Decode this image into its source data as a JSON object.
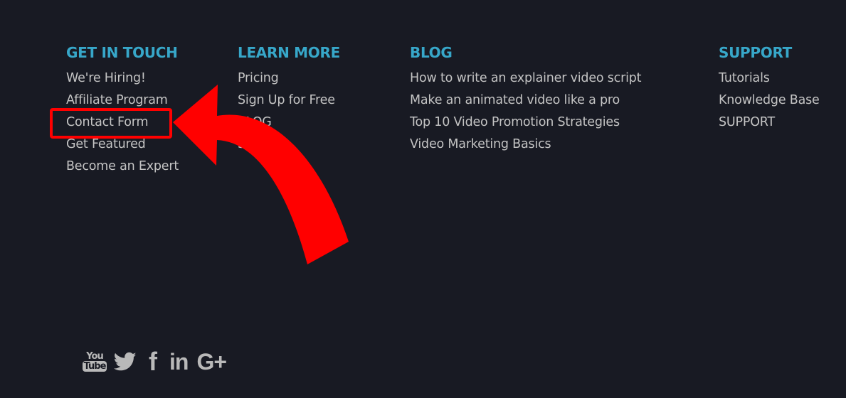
{
  "footer": {
    "columns": [
      {
        "heading": "GET IN TOUCH",
        "links": [
          "We're Hiring!",
          "Affiliate Program",
          "Contact Form",
          "Get Featured",
          "Become an Expert"
        ]
      },
      {
        "heading": "LEARN MORE",
        "links": [
          "Pricing",
          "Sign Up for Free",
          "BLOG",
          "Sitemap"
        ]
      },
      {
        "heading": "BLOG",
        "links": [
          "How to write an explainer video script",
          "Make an animated video like a pro",
          "Top 10 Video Promotion Strategies",
          "Video Marketing Basics"
        ]
      },
      {
        "heading": "SUPPORT",
        "links": [
          "Tutorials",
          "Knowledge Base",
          "SUPPORT"
        ]
      }
    ],
    "social": {
      "youtube_top": "You",
      "youtube_bottom": "Tube",
      "facebook": "f",
      "linkedin": "in",
      "googleplus": "G+"
    }
  },
  "annotation": {
    "highlighted_link": "Contact Form",
    "color": "#ff0000"
  },
  "colors": {
    "background": "#181a23",
    "heading": "#37a7c9",
    "link": "#c4c4c4",
    "icon": "#b9b9b9"
  }
}
